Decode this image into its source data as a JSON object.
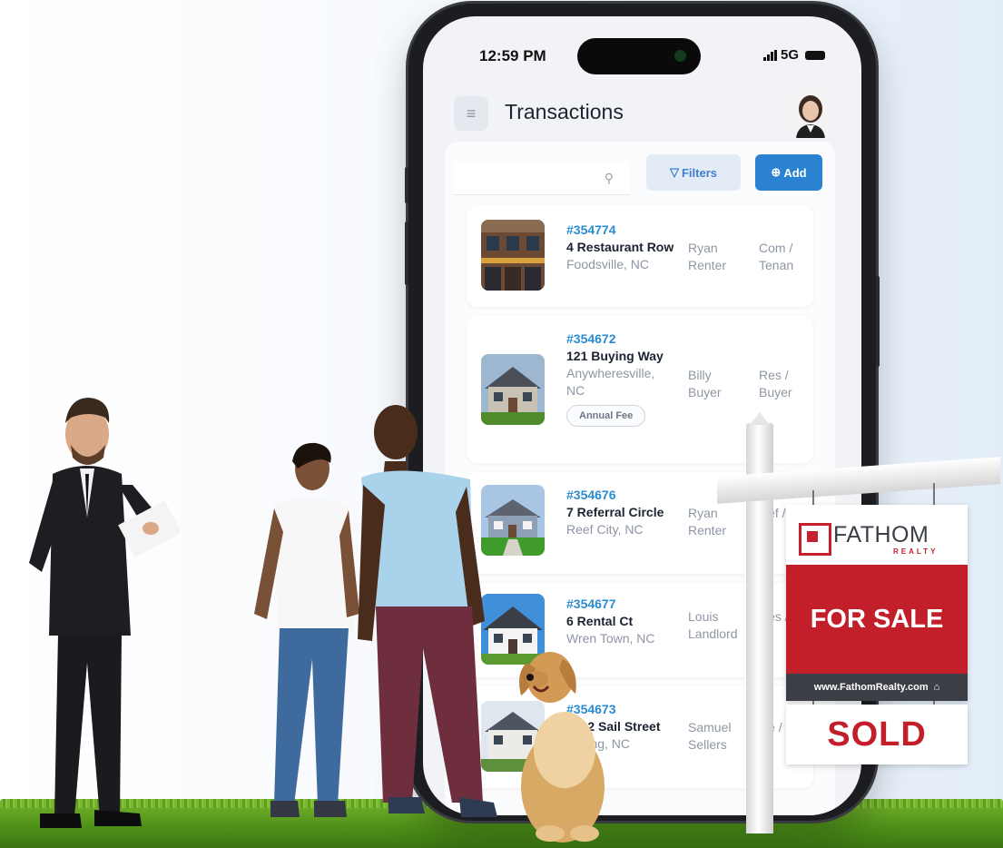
{
  "status_bar": {
    "time": "12:59 PM",
    "network": "5G"
  },
  "app_bar": {
    "title": "Transactions",
    "menu_icon": "hamburger-icon",
    "avatar_icon": "user-avatar"
  },
  "toolbar": {
    "search_placeholder": "",
    "search_icon": "search-icon",
    "filters_label": "Filters",
    "add_label": "Add"
  },
  "transactions": [
    {
      "id": "#354774",
      "street": "4 Restaurant Row",
      "city": "Foodsville, NC",
      "person": "Ryan Renter",
      "type": "Com / Tenan",
      "badge": ""
    },
    {
      "id": "#354672",
      "street": "121 Buying Way",
      "city": "Anywheresville, NC",
      "person": "Billy Buyer",
      "type": "Res / Buyer",
      "badge": "Annual Fee"
    },
    {
      "id": "#354676",
      "street": "7 Referral Circle",
      "city": "Reef City, NC",
      "person": "Ryan Renter",
      "type": "Ref / Bu",
      "badge": ""
    },
    {
      "id": "#354677",
      "street": "6 Rental Ct",
      "city": "Wren Town, NC",
      "person": "Louis Landlord",
      "type": "Res / La",
      "badge": ""
    },
    {
      "id": "#354673",
      "street": "2002 Sail Street",
      "city": "Sailing, NC",
      "person": "Samuel Sellers",
      "type": "Re / Se",
      "badge": ""
    }
  ],
  "sign": {
    "brand": "FATHOM",
    "brand_sub": "REALTY",
    "headline": "FOR SALE",
    "url": "www.FathomRealty.com",
    "rider": "SOLD"
  },
  "colors": {
    "accent_blue": "#2a82d1",
    "id_blue": "#2a8bd0",
    "sign_red": "#c21f2b",
    "grass_green": "#4c8f18"
  }
}
